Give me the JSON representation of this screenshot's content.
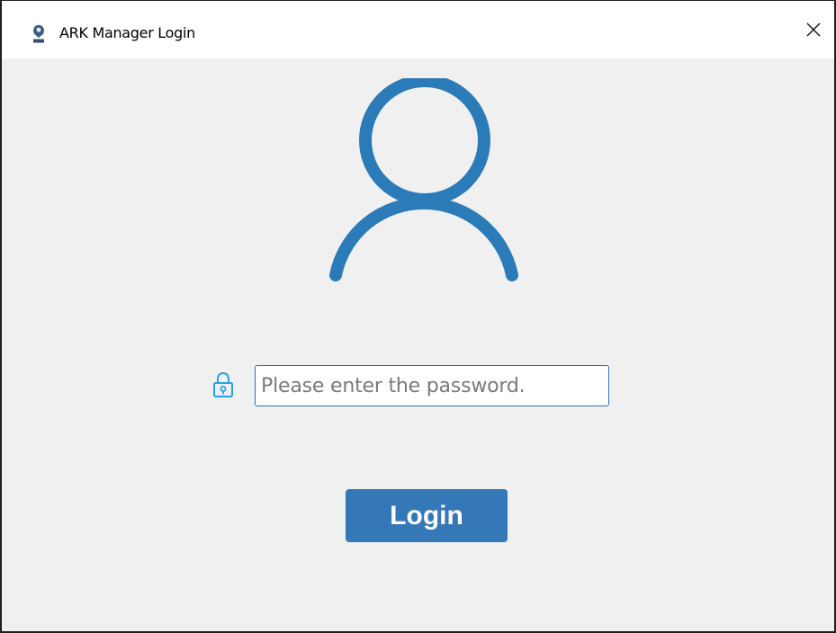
{
  "window": {
    "title": "ARK Manager Login",
    "app_icon": "ark-logo-icon",
    "close_icon": "close-icon"
  },
  "login": {
    "avatar_icon": "user-avatar-icon",
    "lock_icon": "lock-icon",
    "password_placeholder": "Please enter the password.",
    "password_value": "",
    "login_label": "Login"
  },
  "colors": {
    "accent": "#3578b8",
    "avatar": "#2b7bb9",
    "lock": "#29a3e8",
    "background": "#f0f0f0",
    "titlebar": "#ffffff"
  }
}
